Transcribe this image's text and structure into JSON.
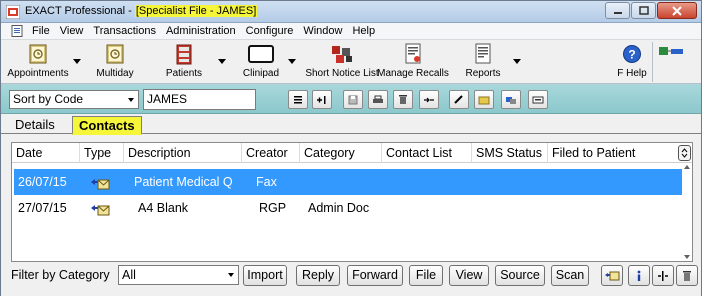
{
  "window": {
    "title_prefix": "EXACT Professional - ",
    "title_highlight": "[Specialist File - JAMES]"
  },
  "menu": [
    "File",
    "View",
    "Transactions",
    "Administration",
    "Configure",
    "Window",
    "Help"
  ],
  "toolbar": {
    "items": [
      {
        "label": "Appointments",
        "icon": "appointments-book-icon"
      },
      {
        "label": "Multiday",
        "icon": "multiday-book-icon"
      },
      {
        "label": "Patients",
        "icon": "patients-cabinet-icon"
      },
      {
        "label": "Clinipad",
        "icon": "clinipad-icon"
      },
      {
        "label": "Short Notice List",
        "icon": "short-notice-puzzle-icon"
      },
      {
        "label": "Manage Recalls",
        "icon": "recalls-document-icon"
      },
      {
        "label": "Reports",
        "icon": "reports-document-icon"
      },
      {
        "label": "F Help",
        "icon": "help-icon"
      }
    ]
  },
  "strip": {
    "sort_value": "Sort by Code",
    "patient_name": "JAMES"
  },
  "tabs": [
    {
      "label": "Details",
      "active": false
    },
    {
      "label": "Contacts",
      "active": true
    }
  ],
  "grid": {
    "columns": [
      "Date",
      "Type",
      "Description",
      "Creator",
      "Category",
      "Contact List",
      "SMS Status",
      "Filed to Patient"
    ],
    "rows": [
      {
        "date": "26/07/15",
        "type_icon": "fax-envelope-icon",
        "description": "Patient Medical Q",
        "creator": "Fax",
        "category": "",
        "selected": true
      },
      {
        "date": "27/07/15",
        "type_icon": "letter-envelope-icon",
        "description": "A4 Blank",
        "creator": "RGP",
        "category": "Admin Doc",
        "selected": false
      }
    ]
  },
  "bottom": {
    "filter_label": "Filter by Category",
    "filter_value": "All",
    "buttons": [
      "Import",
      "Reply",
      "Forward",
      "File",
      "View",
      "Source",
      "Scan"
    ]
  },
  "colors": {
    "highlight": "#f5f53a",
    "selection": "#3399ff",
    "teal_strip": "#9fd1d4"
  }
}
